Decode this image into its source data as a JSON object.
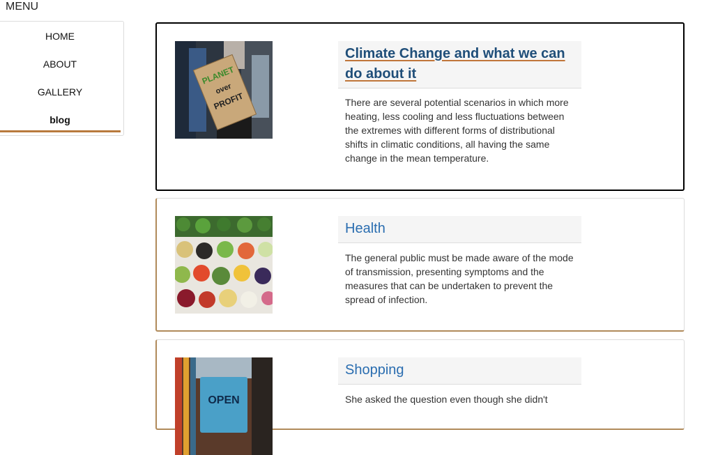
{
  "menu": {
    "title": "MENU",
    "items": [
      {
        "label": "HOME"
      },
      {
        "label": "ABOUT"
      },
      {
        "label": "GALLERY"
      },
      {
        "label": "blog"
      }
    ]
  },
  "posts": [
    {
      "title": "Climate Change and what we can do about it",
      "body": "There are several potential scenarios in which more heating, less cooling and less fluctuations between the extremes with different forms of distributional shifts in climatic conditions, all having the same change in the mean temperature.",
      "image": "protest-sign-image",
      "sign_text": "PLANET over PROFIT"
    },
    {
      "title": "Health",
      "body": "The general public must be made aware of the mode of transmission, presenting symptoms and the measures that can be undertaken to prevent the spread of infection.",
      "image": "vegetable-bowls-image"
    },
    {
      "title": "Shopping",
      "body": "She asked the question even though she didn't",
      "image": "open-sign-image",
      "sign_text": "OPEN"
    }
  ],
  "colors": {
    "accent": "#b87a3d",
    "link": "#1f4e79",
    "title": "#2a6db0"
  }
}
